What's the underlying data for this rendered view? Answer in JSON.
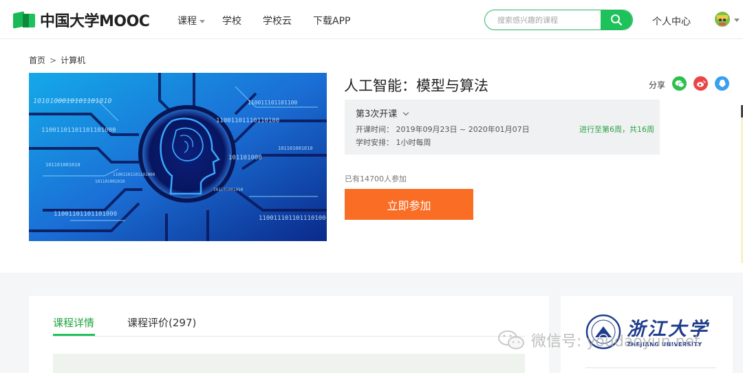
{
  "navbar": {
    "logo_text": "中国大学MOOC",
    "items": [
      {
        "label": "课程",
        "has_caret": true
      },
      {
        "label": "学校"
      },
      {
        "label": "学校云"
      },
      {
        "label": "下载APP"
      }
    ],
    "search": {
      "placeholder": "搜索感兴趣的课程"
    },
    "personal_center": "个人中心"
  },
  "breadcrumb": {
    "home": "首页",
    "separator": ">",
    "current": "计算机"
  },
  "course": {
    "title": "人工智能：模型与算法",
    "share_label": "分享",
    "share_icons": [
      {
        "name": "wechat-icon",
        "color": "#2dc04f"
      },
      {
        "name": "weibo-icon",
        "color": "#ea4545"
      },
      {
        "name": "qq-icon",
        "color": "#3a9ff0"
      }
    ],
    "session": {
      "title": "第3次开课",
      "time": "开课时间： 2019年09月23日 ~ 2020年01月07日",
      "progress": "进行至第6周，共16周",
      "schedule": "学时安排： 1小时每周"
    },
    "enrolled": "已有14700人参加",
    "join_label": "立即参加",
    "cover_texts": [
      "1010100010101101010",
      "11001101101101101000",
      "11001101110110100",
      "110011101101100",
      "101101001010",
      "101101000",
      "101101001010",
      "11001101101101000",
      "11001101101101000",
      "110011101101110100",
      "101101001010",
      "101101001010"
    ]
  },
  "tabs": [
    {
      "label": "课程详情",
      "active": true
    },
    {
      "label": "课程评价(297)",
      "active": false
    }
  ],
  "university": {
    "name_cn": "浙江大学",
    "name_en": "ZHEJIANG UNIVERSITY"
  },
  "watermark": {
    "text": "微信号: youdaoyun.net"
  },
  "colors": {
    "brand_green": "#1ec25b",
    "join_orange": "#fa6d24",
    "progress_green": "#2aa146",
    "uni_blue": "#1f3d8c"
  }
}
